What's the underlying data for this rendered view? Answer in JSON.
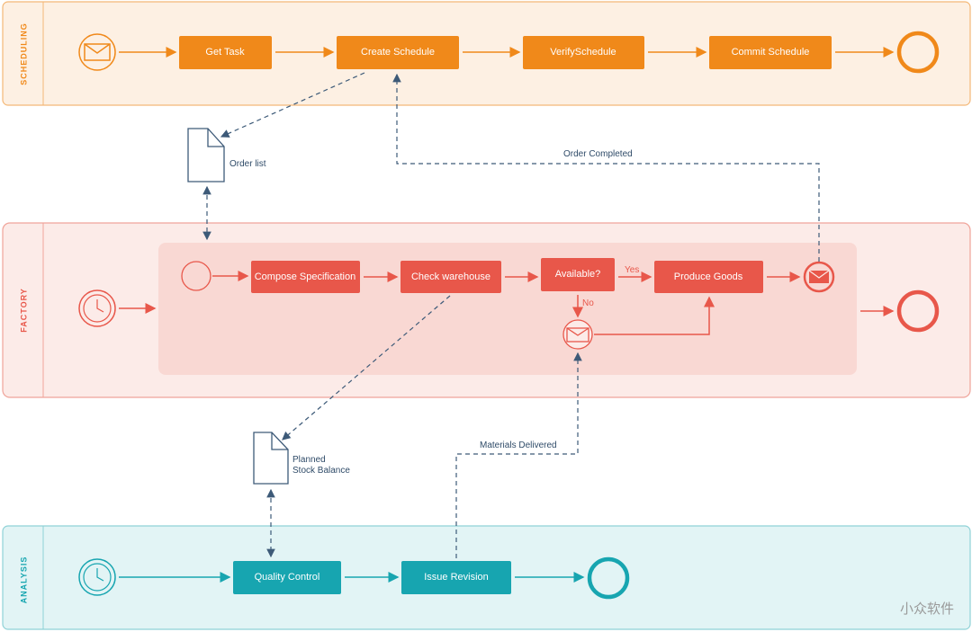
{
  "colors": {
    "scheduling": "#f0891a",
    "factory": "#e8574a",
    "analysis": "#17a5b0",
    "data_flow": "#3d5a78"
  },
  "lanes": {
    "scheduling": {
      "label": "SCHEDULING",
      "tasks": [
        "Get Task",
        "Create Schedule",
        "VerifySchedule",
        "Commit Schedule"
      ]
    },
    "factory": {
      "label": "FACTORY",
      "tasks": [
        "Compose Specification",
        "Check warehouse",
        "Available?",
        "Produce Goods"
      ],
      "gateway_yes": "Yes",
      "gateway_no": "No"
    },
    "analysis": {
      "label": "ANALYSIS",
      "tasks": [
        "Quality Control",
        "Issue Revision"
      ]
    }
  },
  "data_objects": {
    "order_list": "Order list",
    "planned_stock_1": "Planned",
    "planned_stock_2": "Stock Balance"
  },
  "flows": {
    "order_completed": "Order Completed",
    "materials_delivered": "Materials Delivered"
  },
  "watermark": "小众软件"
}
